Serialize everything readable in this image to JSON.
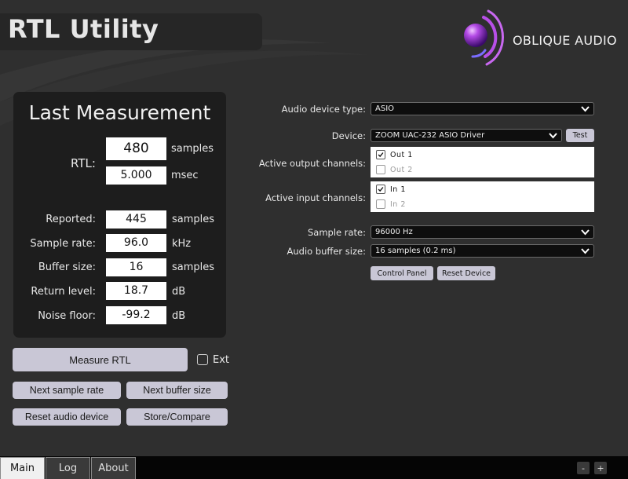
{
  "app": {
    "title": "RTL Utility",
    "brand": "OBLIQUE AUDIO"
  },
  "measurement": {
    "title": "Last Measurement",
    "rtl_label": "RTL:",
    "rtl_samples": "480",
    "rtl_samples_unit": "samples",
    "rtl_msec": "5.000",
    "rtl_msec_unit": "msec",
    "rows": [
      {
        "label": "Reported:",
        "value": "445",
        "unit": "samples"
      },
      {
        "label": "Sample rate:",
        "value": "96.0",
        "unit": "kHz"
      },
      {
        "label": "Buffer size:",
        "value": "16",
        "unit": "samples"
      },
      {
        "label": "Return level:",
        "value": "18.7",
        "unit": "dB"
      },
      {
        "label": "Noise floor:",
        "value": "-99.2",
        "unit": "dB"
      }
    ]
  },
  "buttons": {
    "measure": "Measure RTL",
    "ext": "Ext",
    "next_sample_rate": "Next sample rate",
    "next_buffer_size": "Next buffer size",
    "reset_audio_device": "Reset audio device",
    "store_compare": "Store/Compare"
  },
  "device": {
    "type_label": "Audio device type:",
    "type_value": "ASIO",
    "device_label": "Device:",
    "device_value": "ZOOM UAC-232 ASIO Driver",
    "test": "Test",
    "output_label": "Active output channels:",
    "outputs": [
      {
        "name": "Out 1",
        "checked": true
      },
      {
        "name": "Out 2",
        "checked": false
      }
    ],
    "input_label": "Active input channels:",
    "inputs": [
      {
        "name": "In 1",
        "checked": true
      },
      {
        "name": "In 2",
        "checked": false
      }
    ],
    "sample_rate_label": "Sample rate:",
    "sample_rate_value": "96000 Hz",
    "buffer_label": "Audio buffer size:",
    "buffer_value": "16 samples (0.2 ms)",
    "control_panel": "Control Panel",
    "reset_device": "Reset Device"
  },
  "tabs": [
    "Main",
    "Log",
    "About"
  ],
  "active_tab": "Main",
  "zoom": {
    "minus": "-",
    "plus": "+"
  },
  "colors": {
    "background": "#2f2f2f",
    "panel": "#1d1d1d",
    "button": "#c9c7d6",
    "logo_purple": "#9b3fd6"
  }
}
